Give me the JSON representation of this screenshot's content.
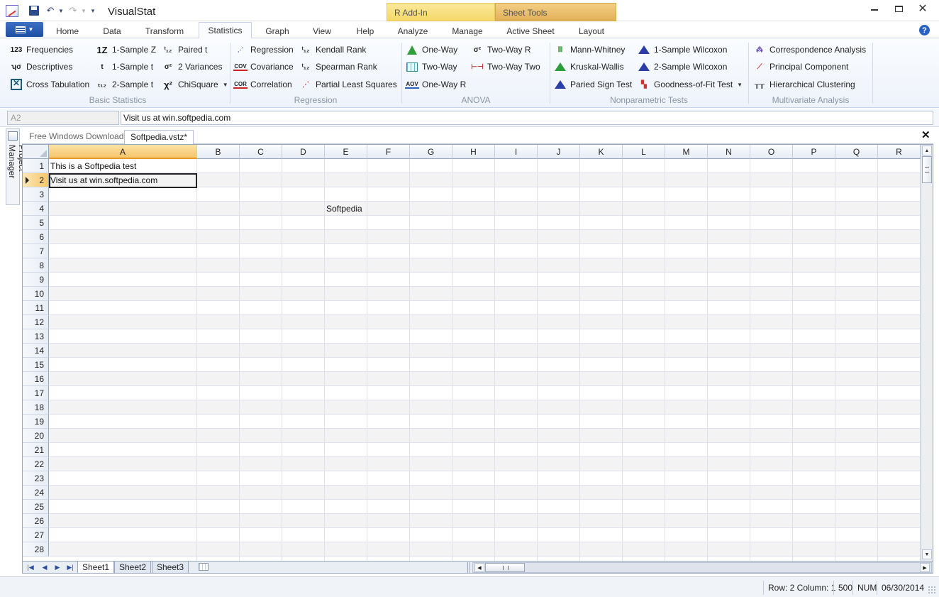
{
  "window": {
    "title": "VisualStat",
    "context_tabs": [
      "R Add-In",
      "Sheet Tools"
    ]
  },
  "ribbon": {
    "tabs": [
      "Home",
      "Data",
      "Transform",
      "Statistics",
      "Graph",
      "View",
      "Help",
      "Analyze",
      "Manage",
      "Active Sheet",
      "Layout"
    ],
    "active_tab": "Statistics",
    "groups": {
      "basic": {
        "label": "Basic Statistics",
        "items": [
          "Frequencies",
          "Descriptives",
          "Cross Tabulation",
          "1-Sample Z",
          "1-Sample t",
          "2-Sample t",
          "Paired t",
          "2 Variances",
          "ChiSquare"
        ]
      },
      "regression": {
        "label": "Regression",
        "items": [
          "Regression",
          "Covariance",
          "Correlation",
          "Kendall Rank",
          "Spearman Rank",
          "Partial Least Squares"
        ]
      },
      "anova": {
        "label": "ANOVA",
        "items": [
          "One-Way",
          "Two-Way",
          "One-Way R",
          "Two-Way R",
          "Two-Way Two"
        ]
      },
      "nonparametric": {
        "label": "Nonparametric Tests",
        "items": [
          "Mann-Whitney",
          "Kruskal-Wallis",
          "Paried Sign Test",
          "1-Sample Wilcoxon",
          "2-Sample Wilcoxon",
          "Goodness-of-Fit Test"
        ]
      },
      "multivariate": {
        "label": "Multivariate Analysis",
        "items": [
          "Correspondence Analysis",
          "Principal Component",
          "Hierarchical Clustering"
        ]
      }
    }
  },
  "formula_bar": {
    "name_box": "A2",
    "value": "Visit us at win.softpedia.com"
  },
  "project_manager": {
    "label": "Project Manager"
  },
  "doc_tabs": [
    "Free Windows Downloads",
    "Softpedia.vstz*"
  ],
  "doc_close": "✕",
  "sheet": {
    "columns": [
      "A",
      "B",
      "C",
      "D",
      "E",
      "F",
      "G",
      "H",
      "I",
      "J",
      "K",
      "L",
      "M",
      "N",
      "O",
      "P",
      "Q",
      "R"
    ],
    "rows": [
      "1",
      "2",
      "3",
      "4",
      "5",
      "6",
      "7",
      "8",
      "9",
      "10",
      "11",
      "12",
      "13",
      "14",
      "15",
      "16",
      "17",
      "18",
      "19",
      "20",
      "21",
      "22",
      "23",
      "24",
      "25",
      "26",
      "27",
      "28"
    ],
    "selected_column": "A",
    "selected_row": "2",
    "cells": {
      "A1": "This is a Softpedia test",
      "A2": "Visit us at win.softpedia.com",
      "E4": "Softpedia"
    },
    "tabs": [
      "Sheet1",
      "Sheet2",
      "Sheet3"
    ],
    "active_tab": "Sheet1"
  },
  "statusbar": {
    "position": "Row: 2 Column: 1",
    "count": "500",
    "numlock": "NUM",
    "date": "06/30/2014"
  }
}
